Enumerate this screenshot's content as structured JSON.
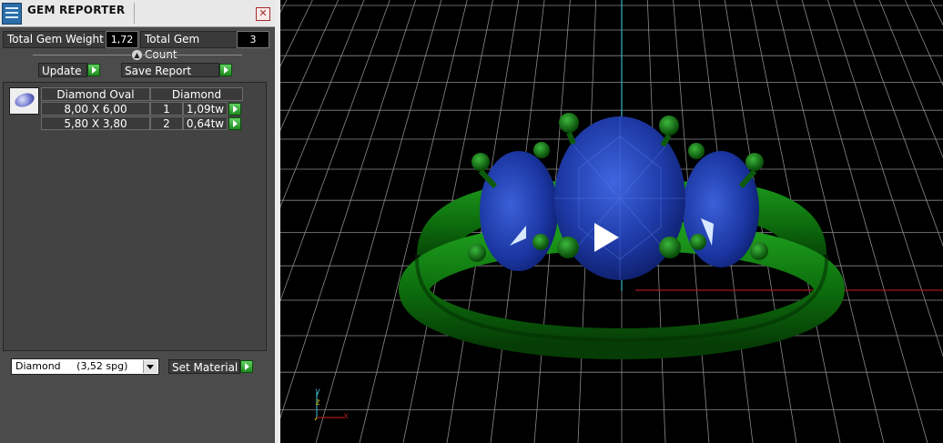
{
  "window": {
    "title": "GEM REPORTER",
    "close_glyph": "✕"
  },
  "summary": {
    "weight_label": "Total Gem Weight",
    "weight_value": "1,72",
    "count_label": "Total Gem Count",
    "count_value": "3"
  },
  "actions": {
    "update_label": "Update",
    "save_label": "Save Report"
  },
  "gem_table": {
    "shape": "Diamond Oval",
    "material": "Diamond",
    "rows": [
      {
        "size": "8,00 X 6,00",
        "count": "1",
        "weight": "1,09tw"
      },
      {
        "size": "5,80 X 3,80",
        "count": "2",
        "weight": "0,64tw"
      }
    ]
  },
  "material": {
    "selected": "Diamond     (3,52 spg)",
    "set_label": "Set Material"
  },
  "viewport": {
    "axis_labels": {
      "y": "y",
      "z": "z",
      "x": "x"
    },
    "colors": {
      "background": "#000000",
      "grid": "#8a8a8a",
      "metal": "#0f6e0f",
      "gem": "#1f3ca8",
      "axis_y": "#38a6b8",
      "axis_x": "#a81818"
    }
  },
  "icons": [
    "app-icon",
    "close-icon",
    "slider-knob-icon",
    "arrow-right-icon",
    "gem-oval-icon",
    "chevron-down-icon",
    "axis-triad-icon"
  ]
}
